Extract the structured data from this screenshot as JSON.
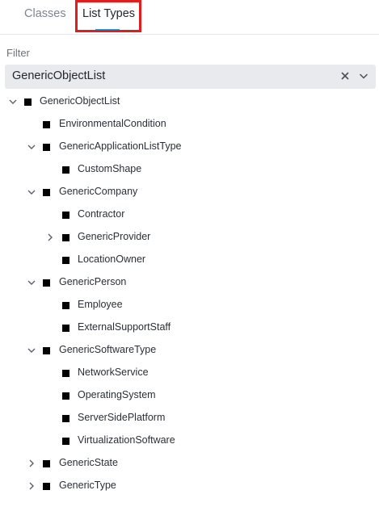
{
  "tabs": {
    "classes_label": "Classes",
    "list_types_label": "List Types"
  },
  "filter": {
    "label": "Filter",
    "value": "GenericObjectList"
  },
  "tree": [
    {
      "label": "GenericObjectList",
      "depth": 0,
      "chevron": "down"
    },
    {
      "label": "EnvironmentalCondition",
      "depth": 1,
      "chevron": "none"
    },
    {
      "label": "GenericApplicationListType",
      "depth": 1,
      "chevron": "down"
    },
    {
      "label": "CustomShape",
      "depth": 2,
      "chevron": "none"
    },
    {
      "label": "GenericCompany",
      "depth": 1,
      "chevron": "down"
    },
    {
      "label": "Contractor",
      "depth": 2,
      "chevron": "none"
    },
    {
      "label": "GenericProvider",
      "depth": 2,
      "chevron": "right"
    },
    {
      "label": "LocationOwner",
      "depth": 2,
      "chevron": "none"
    },
    {
      "label": "GenericPerson",
      "depth": 1,
      "chevron": "down"
    },
    {
      "label": "Employee",
      "depth": 2,
      "chevron": "none"
    },
    {
      "label": "ExternalSupportStaff",
      "depth": 2,
      "chevron": "none"
    },
    {
      "label": "GenericSoftwareType",
      "depth": 1,
      "chevron": "down"
    },
    {
      "label": "NetworkService",
      "depth": 2,
      "chevron": "none"
    },
    {
      "label": "OperatingSystem",
      "depth": 2,
      "chevron": "none"
    },
    {
      "label": "ServerSidePlatform",
      "depth": 2,
      "chevron": "none"
    },
    {
      "label": "VirtualizationSoftware",
      "depth": 2,
      "chevron": "none"
    },
    {
      "label": "GenericState",
      "depth": 1,
      "chevron": "right"
    },
    {
      "label": "GenericType",
      "depth": 1,
      "chevron": "right"
    }
  ],
  "colors": {
    "accent": "#2aa1d8",
    "highlight": "#e21d1d",
    "filter_bg": "#e8eaee"
  },
  "icons": {
    "clear": "close-icon",
    "dropdown": "chevron-down-icon",
    "expanded": "chevron-down-icon",
    "collapsed": "chevron-right-icon",
    "node": "square-icon"
  }
}
